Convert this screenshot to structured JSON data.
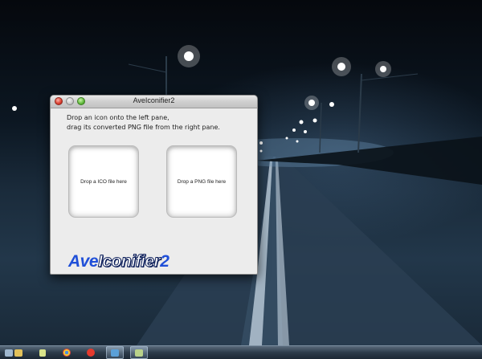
{
  "window": {
    "title": "AveIconifier2",
    "instructions": [
      "Drop an icon onto the left pane,",
      "drag its converted PNG file from the right pane."
    ],
    "left_pane_label": "Drop a ICO file here",
    "right_pane_label": "Drop a PNG file here",
    "logo": {
      "part1": "Ave",
      "part2": "Iconifier",
      "part3": "2"
    },
    "colors": {
      "logo_blue": "#1f4fd8",
      "window_bg": "#ececec"
    }
  },
  "taskbar": {
    "items": [
      {
        "name": "show-desktop",
        "icon": "desktop-icon",
        "color": "#9fb7cf"
      },
      {
        "name": "explorer",
        "icon": "folder-icon",
        "color": "#e2c15a"
      },
      {
        "name": "notepad",
        "icon": "notepad-icon",
        "color": "#d9e48a"
      },
      {
        "name": "chrome",
        "icon": "chrome-icon",
        "color": "#d9453b"
      },
      {
        "name": "yandex",
        "icon": "yandex-icon",
        "color": "#e53a2e"
      },
      {
        "name": "monitor",
        "icon": "monitor-icon",
        "color": "#5aa0d8"
      },
      {
        "name": "aveiconifier",
        "icon": "aveiconifier-icon",
        "color": "#b9d28a"
      }
    ]
  }
}
